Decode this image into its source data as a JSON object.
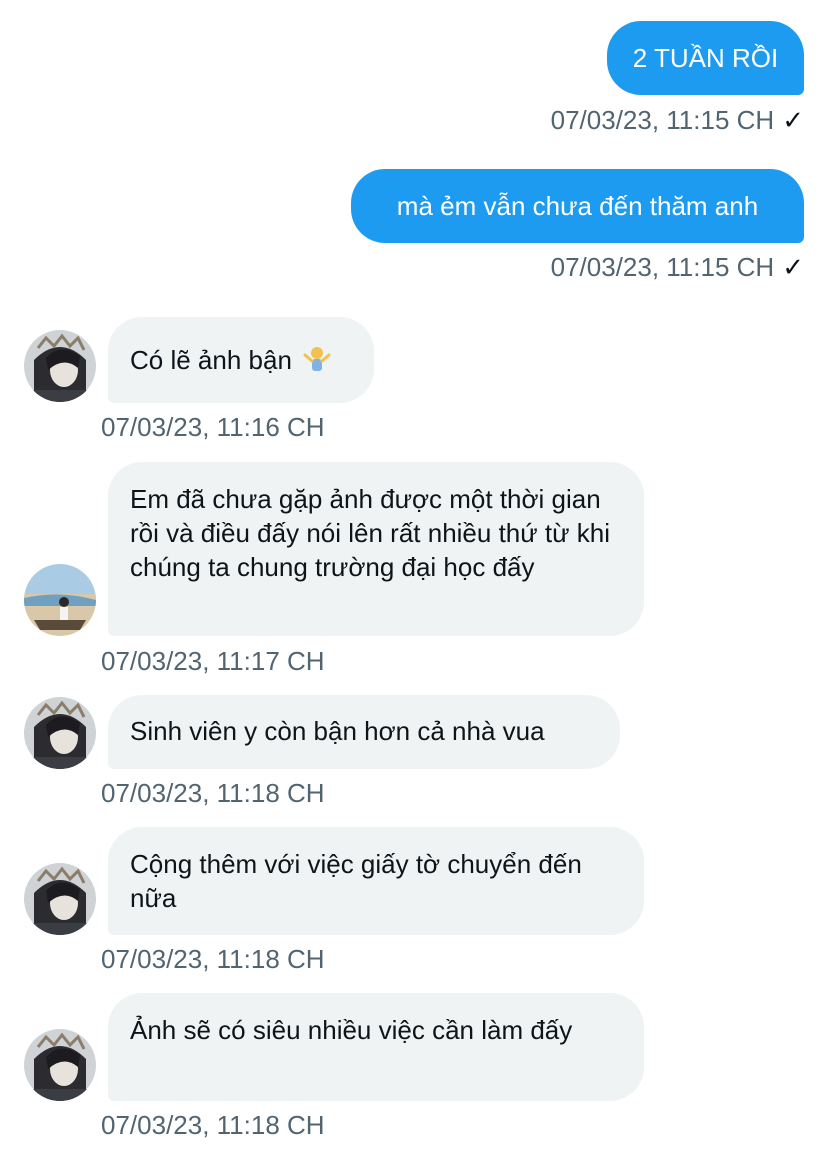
{
  "messages": [
    {
      "text": "2 TUẦN RỒI",
      "time": "07/03/23, 11:15 CH",
      "status": "✓"
    },
    {
      "text": "mà ẻm vẫn chưa đến thăm anh",
      "time": "07/03/23, 11:15 CH",
      "status": "✓"
    },
    {
      "text": "Có lẽ ảnh bận",
      "emoji": "person-shrugging-emoji",
      "time": "07/03/23, 11:16 CH"
    },
    {
      "text": "Em đã chưa gặp ảnh được một thời gian rồi và điều đấy nói lên rất nhiều thứ từ khi chúng ta chung trường đại học đấy",
      "time": "07/03/23, 11:17 CH"
    },
    {
      "text": "Sinh viên y còn bận hơn cả nhà vua",
      "time": "07/03/23, 11:18 CH"
    },
    {
      "text": "Cộng thêm với việc giấy tờ chuyển đến nữa",
      "time": "07/03/23, 11:18 CH"
    },
    {
      "text": "Ảnh sẽ có siêu nhiều việc cần làm đấy",
      "time": "07/03/23, 11:18 CH"
    }
  ],
  "colors": {
    "outgoing_bubble": "#1d9bf0",
    "incoming_bubble": "#eff3f4",
    "timestamp": "#536471"
  }
}
